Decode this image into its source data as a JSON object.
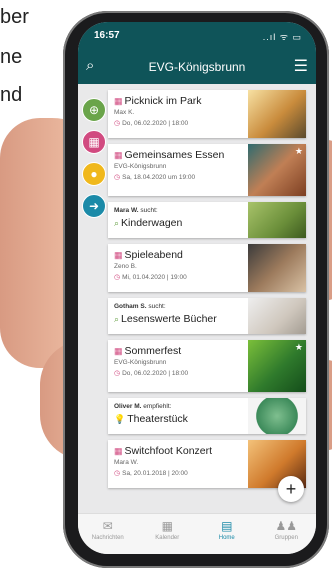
{
  "bg_text": {
    "line1": "ber",
    "line2": "ne",
    "line3": "nd",
    "line4": ","
  },
  "status": {
    "time": "16:57",
    "icons": "..ıl ᯤ ▭"
  },
  "header": {
    "title": "EVG-Königsbrunn",
    "left_icon": "search-icon",
    "right_icon": "menu-icon"
  },
  "side_buttons": [
    {
      "icon": "globe-icon",
      "color": "#6aa44a"
    },
    {
      "icon": "calendar-icon",
      "color": "#d14a80"
    },
    {
      "icon": "bulb-icon",
      "color": "#f0b81c"
    },
    {
      "icon": "arrow-icon",
      "color": "#1b8aa8"
    }
  ],
  "cards": [
    {
      "title": "Picknick im Park",
      "sub": "Max K.",
      "date": "Do, 06.02.2020 | 18:00",
      "star": false
    },
    {
      "title": "Gemeinsames Essen",
      "sub": "EVG-Königsbrunn",
      "date": "Sa, 18.04.2020 um 19:00",
      "star": true
    },
    {
      "prefix_name": "Mara W.",
      "prefix_verb": "sucht:",
      "title": "Kinderwagen"
    },
    {
      "title": "Spieleabend",
      "sub": "Zeno B.",
      "date": "Mi, 01.04.2020 | 19:00"
    },
    {
      "prefix_name": "Gotham S.",
      "prefix_verb": "sucht:",
      "title": "Lesenswerte Bücher"
    },
    {
      "title": "Sommerfest",
      "sub": "EVG-Königsbrunn",
      "date": "Do, 06.02.2020 | 18:00",
      "star": true
    },
    {
      "prefix_name": "Oliver M.",
      "prefix_verb": "empfiehlt:",
      "title": "Theaterstück"
    },
    {
      "title": "Switchfoot Konzert",
      "sub": "Mara W.",
      "date": "Sa, 20.01.2018 | 20:00"
    }
  ],
  "fab": {
    "label": "+"
  },
  "tabs": [
    {
      "label": "Nachrichten",
      "icon": "mail-icon",
      "active": false
    },
    {
      "label": "Kalender",
      "icon": "calendar-icon",
      "active": false
    },
    {
      "label": "Home",
      "icon": "home-icon",
      "active": true
    },
    {
      "label": "Gruppen",
      "icon": "group-icon",
      "active": false
    }
  ]
}
